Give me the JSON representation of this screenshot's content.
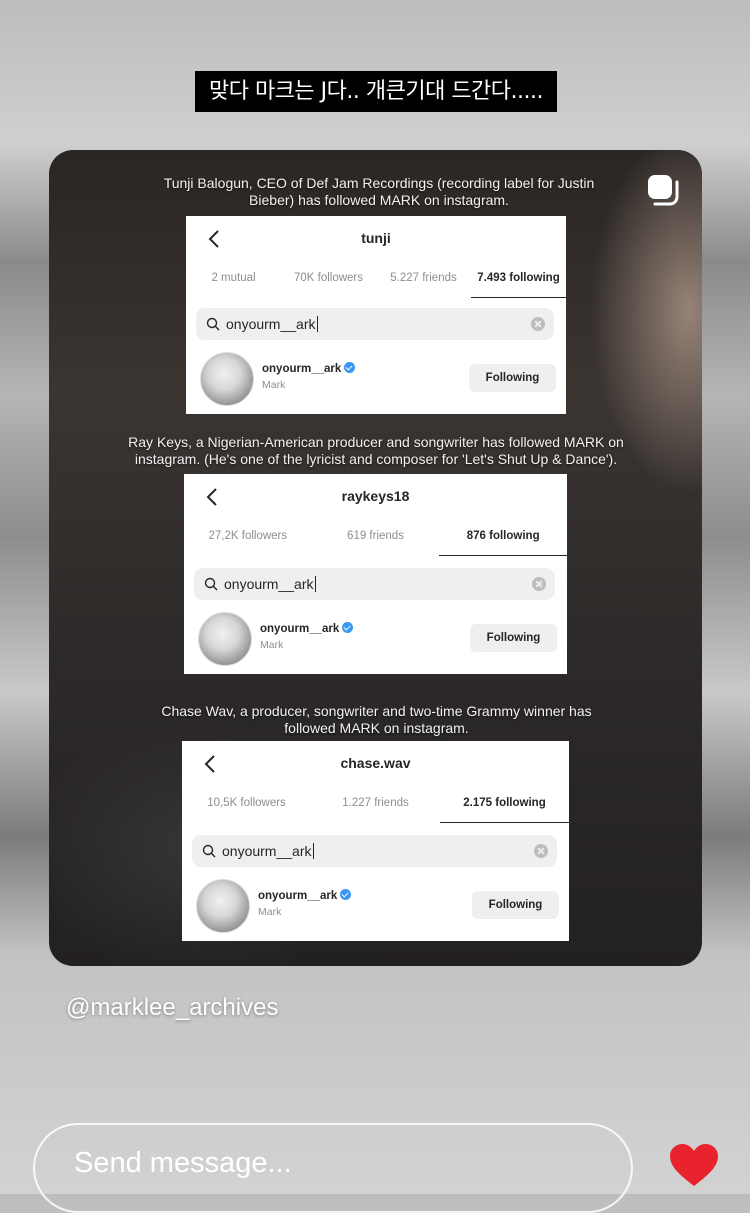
{
  "story": {
    "caption": "맞다 마크는 J다.. 개큰기대 드간다.....",
    "credit": "@marklee_archives",
    "send_placeholder": "Send message..."
  },
  "notes": [
    "Tunji Balogun, CEO of Def Jam Recordings (recording label for Justin Bieber) has followed MARK on instagram.",
    "Ray Keys, a Nigerian-American producer and songwriter has followed MARK on instagram. (He's one of the lyricist and composer for 'Let's Shut Up & Dance').",
    "Chase Wav, a producer, songwriter and two-time Grammy winner has followed MARK on instagram."
  ],
  "panels": [
    {
      "username": "tunji",
      "tabs": [
        "2 mutual",
        "70K followers",
        "5.227 friends",
        "7.493 following"
      ],
      "search": "onyourm__ark",
      "result": {
        "handle": "onyourm__ark",
        "name": "Mark",
        "button": "Following"
      }
    },
    {
      "username": "raykeys18",
      "tabs": [
        "27,2K followers",
        "619 friends",
        "876 following"
      ],
      "search": "onyourm__ark",
      "result": {
        "handle": "onyourm__ark",
        "name": "Mark",
        "button": "Following"
      }
    },
    {
      "username": "chase.wav",
      "tabs": [
        "10,5K followers",
        "1.227 friends",
        "2.175 following"
      ],
      "search": "onyourm__ark",
      "result": {
        "handle": "onyourm__ark",
        "name": "Mark",
        "button": "Following"
      }
    }
  ],
  "icons": {
    "heart": "heart-icon",
    "repost": "repost-icon",
    "back": "chevron-left-icon",
    "search": "search-icon",
    "clear": "clear-icon",
    "verified": "verified-badge-icon"
  },
  "colors": {
    "heart": "#e8232d",
    "verified": "#3897f0"
  }
}
